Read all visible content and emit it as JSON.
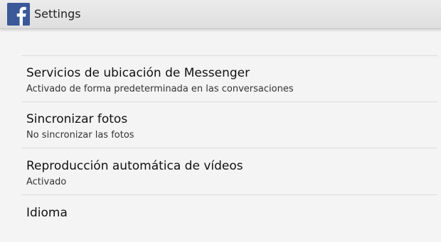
{
  "colors": {
    "facebook_blue": "#3b5998",
    "action_bar_bg": "#e6e6e6",
    "divider": "#dcdcdc"
  },
  "action_bar": {
    "logo_icon": "facebook-logo-icon",
    "title": "Settings"
  },
  "settings": {
    "items": [
      {
        "title": "Servicios de ubicación de Messenger",
        "summary": "Activado de forma predeterminada en las conversaciones"
      },
      {
        "title": "Sincronizar fotos",
        "summary": "No sincronizar las fotos"
      },
      {
        "title": "Reproducción automática de vídeos",
        "summary": "Activado"
      },
      {
        "title": "Idioma"
      }
    ]
  }
}
